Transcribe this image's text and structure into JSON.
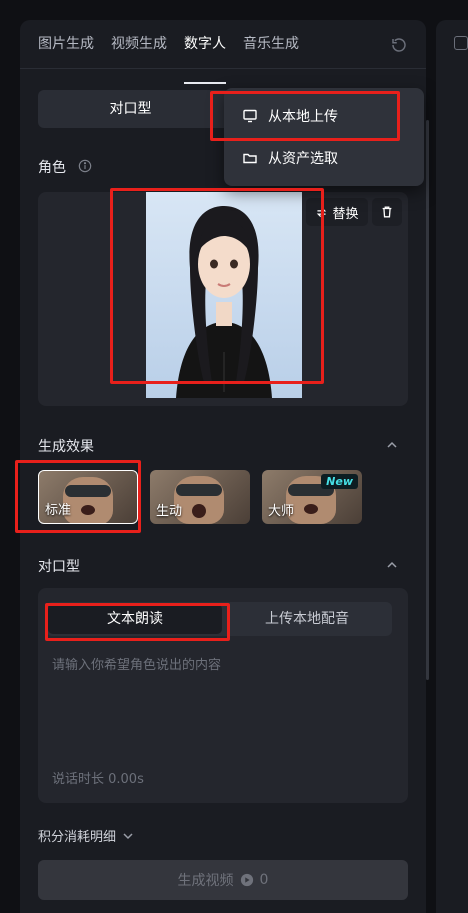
{
  "tabs": {
    "items": [
      {
        "label": "图片生成"
      },
      {
        "label": "视频生成"
      },
      {
        "label": "数字人"
      },
      {
        "label": "音乐生成"
      }
    ],
    "active_index": 2
  },
  "mode": {
    "label": "对口型"
  },
  "upload_menu": {
    "local_upload": "从本地上传",
    "from_assets": "从资产选取"
  },
  "role": {
    "title": "角色",
    "replace_label": "替换"
  },
  "effects": {
    "title": "生成效果",
    "items": [
      {
        "label": "标准",
        "selected": true,
        "badge": ""
      },
      {
        "label": "生动",
        "selected": false,
        "badge": ""
      },
      {
        "label": "大师",
        "selected": false,
        "badge": "New"
      }
    ]
  },
  "lip_sync": {
    "title": "对口型",
    "tab_text": "文本朗读",
    "tab_upload": "上传本地配音",
    "placeholder": "请输入你希望角色说出的内容",
    "duration": "说话时长 0.00s"
  },
  "points_detail": "积分消耗明细",
  "generate": {
    "label": "生成视频",
    "cost": "0"
  },
  "colors": {
    "highlight": "#e8201b",
    "panel": "#1a1c22",
    "badge_text": "#46e0e6"
  }
}
